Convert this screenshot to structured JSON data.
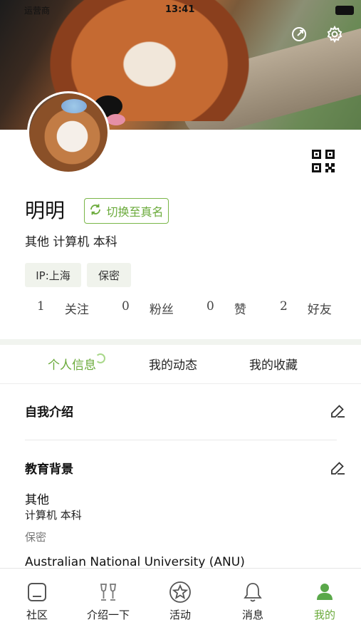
{
  "status": {
    "carrier": "运营商",
    "time": "13:41"
  },
  "profile": {
    "name": "明明",
    "switch_label": "切换至真名",
    "subinfo": "其他 计算机 本科",
    "tags": [
      "IP:上海",
      "保密"
    ],
    "stats": [
      {
        "num": "1",
        "label": "关注"
      },
      {
        "num": "0",
        "label": "粉丝"
      },
      {
        "num": "0",
        "label": "赞"
      },
      {
        "num": "2",
        "label": "好友"
      }
    ]
  },
  "tabs": [
    {
      "label": "个人信息",
      "active": true
    },
    {
      "label": "我的动态"
    },
    {
      "label": "我的收藏"
    }
  ],
  "intro": {
    "title": "自我介绍"
  },
  "education": {
    "title": "教育背景",
    "line1": "其他",
    "line2": "计算机 本科",
    "line3": "保密",
    "university": "Australian National University (ANU)"
  },
  "nav": [
    {
      "label": "社区",
      "icon": "community-icon"
    },
    {
      "label": "介绍一下",
      "icon": "cheers-icon"
    },
    {
      "label": "活动",
      "icon": "star-badge-icon"
    },
    {
      "label": "消息",
      "icon": "bell-icon"
    },
    {
      "label": "我的",
      "icon": "person-icon",
      "active": true
    }
  ],
  "colors": {
    "accent": "#6aaa3a",
    "tag_bg": "#f0f3ec"
  }
}
